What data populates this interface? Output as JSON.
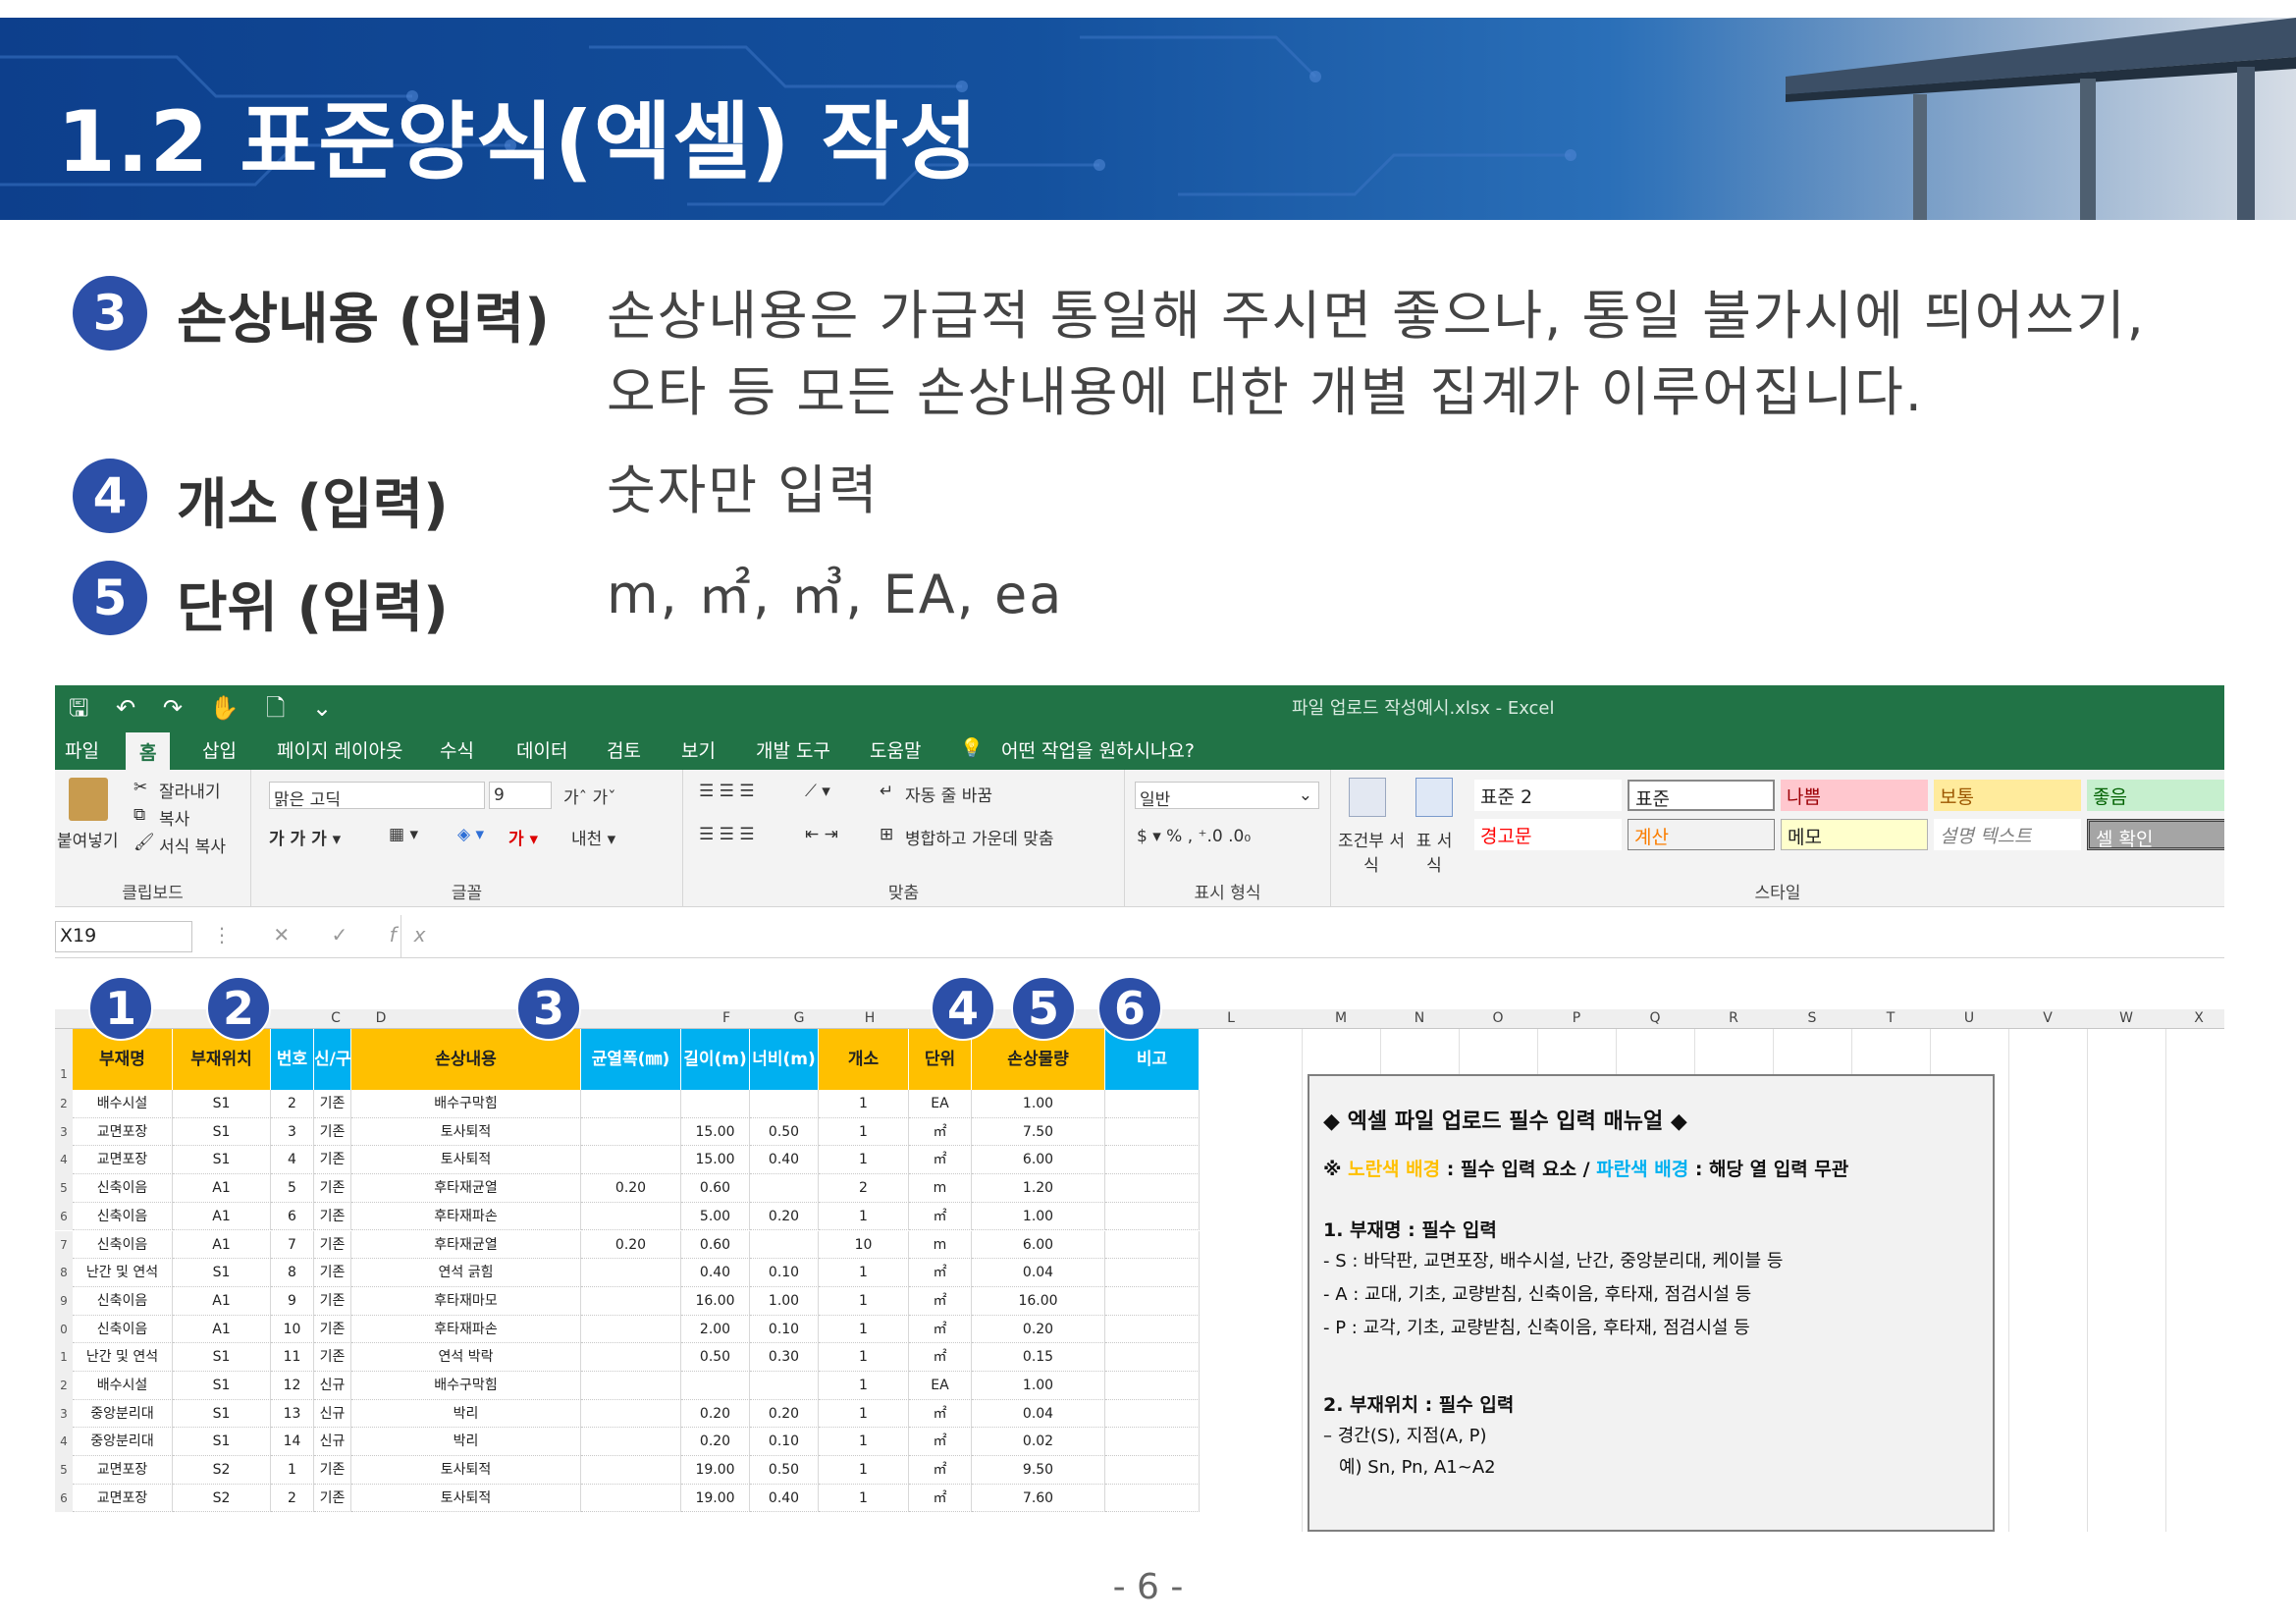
{
  "slide": {
    "title": "1.2 표준양식(엑셀) 작성",
    "page_number": "- 6 -"
  },
  "items": [
    {
      "num": "3",
      "label": "손상내용 (입력)",
      "lines": [
        "손상내용은 가급적 통일해 주시면 좋으나, 통일 불가시에 띄어쓰기,",
        "오타 등 모든 손상내용에 대한 개별 집계가 이루어집니다."
      ]
    },
    {
      "num": "4",
      "label": "개소 (입력)",
      "lines": [
        "숫자만 입력"
      ]
    },
    {
      "num": "5",
      "label": "단위 (입력)",
      "lines": [
        "m, ㎡, ㎥, EA, ea"
      ]
    }
  ],
  "excel": {
    "window_title": "파일 업로드 작성예시.xlsx  -  Excel",
    "quick_access": "🖫 ↶ ↷ ✋ 🗋 ⌄",
    "tabs": [
      "파일",
      "홈",
      "삽입",
      "페이지 레이아웃",
      "수식",
      "데이터",
      "검토",
      "보기",
      "개발 도구",
      "도움말",
      "어떤 작업을 원하시나요?"
    ],
    "ribbon": {
      "clipboard": {
        "paste": "붙여넣기",
        "cut": "잘라내기",
        "copy": "복사",
        "format_painter": "서식 복사",
        "group": "클립보드"
      },
      "font": {
        "font_name": "맑은 고딕",
        "font_size": "9",
        "group": "글꼴"
      },
      "alignment": {
        "wrap": "자동 줄 바꿈",
        "merge": "병합하고 가운데 맞춤",
        "group": "맞춤"
      },
      "number": {
        "format": "일반",
        "group": "표시 형식"
      },
      "styles": {
        "conditional": "조건부 서식",
        "table": "표 서식",
        "group": "스타일",
        "cells": [
          {
            "label": "표준 2",
            "bg": "#ffffff",
            "fg": "#222222"
          },
          {
            "label": "표준",
            "bg": "#ffffff",
            "fg": "#222222"
          },
          {
            "label": "나쁨",
            "bg": "#ffc7ce",
            "fg": "#9c0006"
          },
          {
            "label": "보통",
            "bg": "#ffeb9c",
            "fg": "#9c5700"
          },
          {
            "label": "좋음",
            "bg": "#c6efce",
            "fg": "#006100"
          },
          {
            "label": "경고문",
            "bg": "#ffffff",
            "fg": "#ff0000"
          },
          {
            "label": "계산",
            "bg": "#f2f2f2",
            "fg": "#fa7d00"
          },
          {
            "label": "메모",
            "bg": "#ffffcc",
            "fg": "#222222"
          },
          {
            "label": "설명 텍스트",
            "bg": "#ffffff",
            "fg": "#7f7f7f"
          },
          {
            "label": "셀 확인",
            "bg": "#a5a5a5",
            "fg": "#ffffff"
          }
        ]
      }
    },
    "name_box": "X19",
    "fx": "fx",
    "column_letters": [
      "C",
      "D",
      "F",
      "G",
      "H",
      "L",
      "M",
      "N",
      "O",
      "P",
      "Q",
      "R",
      "S",
      "T",
      "U",
      "V",
      "W",
      "X"
    ],
    "bubbles": [
      "1",
      "2",
      "3",
      "4",
      "5",
      "6"
    ],
    "headers": [
      "부재명",
      "부재위치",
      "번호",
      "신/구",
      "손상내용",
      "균열폭(㎜)",
      "길이(m)",
      "너비(m)",
      "개소",
      "단위",
      "손상물량",
      "비고"
    ],
    "rows": [
      [
        "배수시설",
        "S1",
        "2",
        "기존",
        "배수구막힘",
        "",
        "",
        "",
        "1",
        "EA",
        "1.00",
        ""
      ],
      [
        "교면포장",
        "S1",
        "3",
        "기존",
        "토사퇴적",
        "",
        "15.00",
        "0.50",
        "1",
        "㎡",
        "7.50",
        ""
      ],
      [
        "교면포장",
        "S1",
        "4",
        "기존",
        "토사퇴적",
        "",
        "15.00",
        "0.40",
        "1",
        "㎡",
        "6.00",
        ""
      ],
      [
        "신축이음",
        "A1",
        "5",
        "기존",
        "후타재균열",
        "0.20",
        "0.60",
        "",
        "2",
        "m",
        "1.20",
        ""
      ],
      [
        "신축이음",
        "A1",
        "6",
        "기존",
        "후타재파손",
        "",
        "5.00",
        "0.20",
        "1",
        "㎡",
        "1.00",
        ""
      ],
      [
        "신축이음",
        "A1",
        "7",
        "기존",
        "후타재균열",
        "0.20",
        "0.60",
        "",
        "10",
        "m",
        "6.00",
        ""
      ],
      [
        "난간 및 연석",
        "S1",
        "8",
        "기존",
        "연석 긁힘",
        "",
        "0.40",
        "0.10",
        "1",
        "㎡",
        "0.04",
        ""
      ],
      [
        "신축이음",
        "A1",
        "9",
        "기존",
        "후타재마모",
        "",
        "16.00",
        "1.00",
        "1",
        "㎡",
        "16.00",
        ""
      ],
      [
        "신축이음",
        "A1",
        "10",
        "기존",
        "후타재파손",
        "",
        "2.00",
        "0.10",
        "1",
        "㎡",
        "0.20",
        ""
      ],
      [
        "난간 및 연석",
        "S1",
        "11",
        "기존",
        "연석 박락",
        "",
        "0.50",
        "0.30",
        "1",
        "㎡",
        "0.15",
        ""
      ],
      [
        "배수시설",
        "S1",
        "12",
        "신규",
        "배수구막힘",
        "",
        "",
        "",
        "1",
        "EA",
        "1.00",
        ""
      ],
      [
        "중앙분리대",
        "S1",
        "13",
        "신규",
        "박리",
        "",
        "0.20",
        "0.20",
        "1",
        "㎡",
        "0.04",
        ""
      ],
      [
        "중앙분리대",
        "S1",
        "14",
        "신규",
        "박리",
        "",
        "0.20",
        "0.10",
        "1",
        "㎡",
        "0.02",
        ""
      ],
      [
        "교면포장",
        "S2",
        "1",
        "기존",
        "토사퇴적",
        "",
        "19.00",
        "0.50",
        "1",
        "㎡",
        "9.50",
        ""
      ],
      [
        "교면포장",
        "S2",
        "2",
        "기존",
        "토사퇴적",
        "",
        "19.00",
        "0.40",
        "1",
        "㎡",
        "7.60",
        ""
      ]
    ],
    "row_numbers": [
      "1",
      "2",
      "3",
      "4",
      "5",
      "6",
      "7",
      "8",
      "9",
      "0",
      "1",
      "2",
      "3",
      "4",
      "5",
      "6"
    ],
    "manual": {
      "title": "◆ 엑셀 파일 업로드 필수 입력 매뉴얼 ◆",
      "legend_prefix": "※ ",
      "yellow_text": "노란색 배경",
      "legend_mid": " : 필수 입력 요소 / ",
      "blue_text": "파란색 배경",
      "legend_end": " : 해당 열 입력 무관",
      "sec1_title": "1. 부재명 : 필수 입력",
      "sec1_lines": [
        "- S : 바닥판, 교면포장, 배수시설, 난간, 중앙분리대, 케이블 등",
        "- A : 교대, 기초, 교량받침, 신축이음, 후타재, 점검시설 등",
        "- P : 교각, 기초, 교량받침, 신축이음, 후타재, 점검시설 등"
      ],
      "sec2_title": "2. 부재위치 : 필수 입력",
      "sec2_lines": [
        "– 경간(S), 지점(A, P)",
        "예) Sn, Pn, A1~A2"
      ]
    }
  },
  "colors": {
    "banner": "#14519e",
    "bubble": "#2c4fa8",
    "excel_green": "#217346",
    "header_yellow": "#ffc000",
    "header_blue": "#00b0f0"
  }
}
